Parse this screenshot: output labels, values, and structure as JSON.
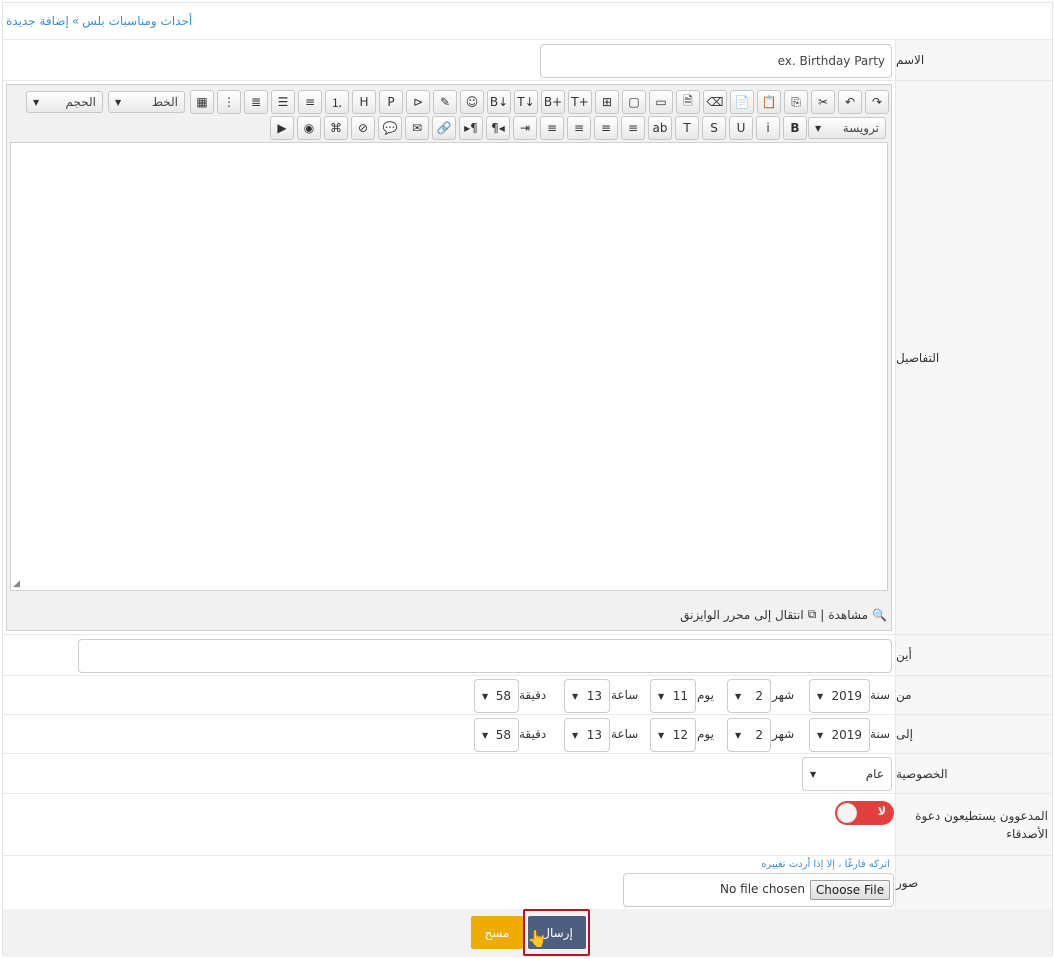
{
  "breadcrumb": {
    "parent": "أحداث ومناسبات بلس",
    "separator": "»",
    "current": "إضافة جديدة"
  },
  "form": {
    "name": {
      "label": "الاسم",
      "placeholder": "ex. Birthday Party"
    },
    "details": {
      "label": "التفاصيل"
    },
    "where": {
      "label": "أين",
      "placeholder": ""
    },
    "from": {
      "label": "من",
      "year_label": "سنة",
      "year": "2019",
      "month_label": "شهر",
      "month": "2",
      "day_label": "يوم",
      "day": "11",
      "hour_label": "ساعة",
      "hour": "13",
      "minute_label": "دقيقة",
      "minute": "58"
    },
    "to": {
      "label": "إلى",
      "year_label": "سنة",
      "year": "2019",
      "month_label": "شهر",
      "month": "2",
      "day_label": "يوم",
      "day": "12",
      "hour_label": "ساعة",
      "hour": "13",
      "minute_label": "دقيقة",
      "minute": "58"
    },
    "privacy": {
      "label": "الخصوصية",
      "value": "عام"
    },
    "invite": {
      "label": "المدعوون يستطيعون دعوة الأصدقاء",
      "toggle_text": "لا",
      "enabled": false
    },
    "photos": {
      "label": "صور",
      "hint": "اتركه فارغًا ، إلا إذا أردت تغييره",
      "button": "Choose File",
      "status": "No file chosen"
    }
  },
  "editor": {
    "size_label": "الحجم",
    "font_label": "الخط",
    "heading_label": "ترويسة",
    "preview_label": "مشاهدة",
    "separator": "|",
    "wysiwyg_label": "انتقال إلى محرر الوايزنق",
    "row1_icons": [
      "redo-icon",
      "undo-icon",
      "cut-icon",
      "copy-icon",
      "paste-icon",
      "paste-text-icon",
      "eraser-icon",
      "code-icon",
      "box-icon",
      "image-icon",
      "image-add-icon",
      "text-add-icon",
      "bbcode-add-icon",
      "text-down-icon",
      "bbcode-down-icon",
      "smiley-icon",
      "note-edit-icon",
      "console-icon",
      "php-icon",
      "html-icon",
      "ordered-list-icon",
      "list-icon",
      "list-alt-icon",
      "indent-list-icon",
      "indent-list-alt-icon",
      "qr-icon"
    ],
    "row1_glyphs": [
      "↷",
      "↶",
      "✂",
      "⎘",
      "📋",
      "📄",
      "⌫",
      "🗎",
      "▭",
      "▢",
      "⊞",
      "T+",
      "B+",
      "T↓",
      "B↓",
      "☺",
      "✎",
      "⊳",
      "P",
      "H",
      "⒈",
      "≡",
      "☰",
      "≣",
      "⋮",
      "▦"
    ],
    "row2_icons": [
      "bold-icon",
      "italic-icon",
      "underline-icon",
      "strike-icon",
      "text-color-icon",
      "highlight-icon",
      "align-right-icon",
      "align-center-icon",
      "align-left-icon",
      "justify-icon",
      "indent-icon",
      "rtl-icon",
      "ltr-icon",
      "link-icon",
      "email-icon",
      "quote-icon",
      "unlink-icon",
      "image-gallery-icon",
      "camera-icon",
      "video-icon"
    ],
    "row2_glyphs": [
      "B",
      "i",
      "U",
      "S",
      "T",
      "ab",
      "≡",
      "≡",
      "≡",
      "≡",
      "⇥",
      "¶◂",
      "▸¶",
      "🔗",
      "✉",
      "💬",
      "⊘",
      "⌘",
      "◉",
      "▶"
    ]
  },
  "actions": {
    "submit": "إرسال",
    "reset": "مسح"
  }
}
